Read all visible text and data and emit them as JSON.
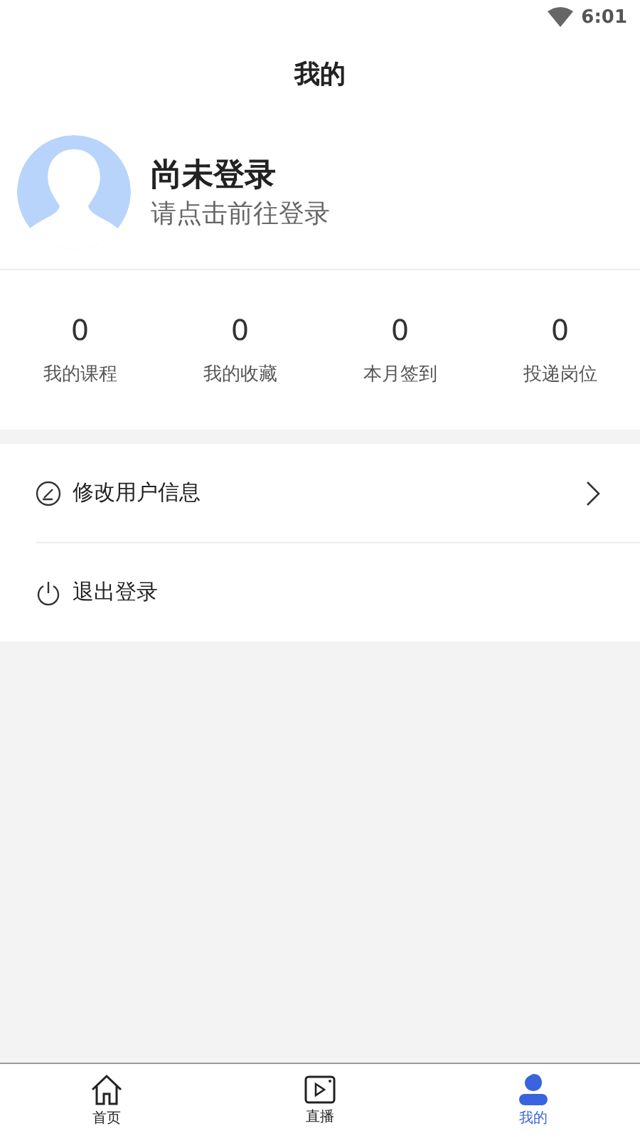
{
  "status_bar": {
    "time": "6:01"
  },
  "title": "我的",
  "profile": {
    "name": "尚未登录",
    "hint": "请点击前往登录"
  },
  "stats": [
    {
      "value": "0",
      "label": "我的课程"
    },
    {
      "value": "0",
      "label": "我的收藏"
    },
    {
      "value": "0",
      "label": "本月签到"
    },
    {
      "value": "0",
      "label": "投递岗位"
    }
  ],
  "menu": [
    {
      "kind": "edit",
      "label": "修改用户信息"
    },
    {
      "kind": "logout",
      "label": "退出登录"
    }
  ],
  "tabs": [
    {
      "kind": "home",
      "label": "首页",
      "selected": false
    },
    {
      "kind": "live",
      "label": "直播",
      "selected": false
    },
    {
      "kind": "me",
      "label": "我的",
      "selected": true
    }
  ]
}
